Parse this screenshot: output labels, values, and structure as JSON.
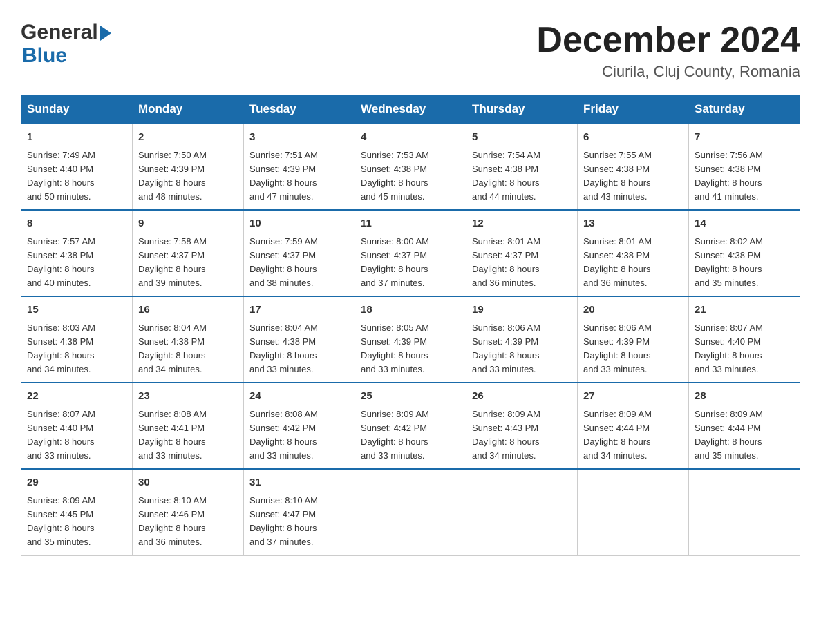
{
  "header": {
    "month_title": "December 2024",
    "location": "Ciurila, Cluj County, Romania",
    "logo_general": "General",
    "logo_blue": "Blue"
  },
  "days_of_week": [
    "Sunday",
    "Monday",
    "Tuesday",
    "Wednesday",
    "Thursday",
    "Friday",
    "Saturday"
  ],
  "weeks": [
    [
      {
        "day": "1",
        "sunrise": "7:49 AM",
        "sunset": "4:40 PM",
        "daylight": "8 hours and 50 minutes."
      },
      {
        "day": "2",
        "sunrise": "7:50 AM",
        "sunset": "4:39 PM",
        "daylight": "8 hours and 48 minutes."
      },
      {
        "day": "3",
        "sunrise": "7:51 AM",
        "sunset": "4:39 PM",
        "daylight": "8 hours and 47 minutes."
      },
      {
        "day": "4",
        "sunrise": "7:53 AM",
        "sunset": "4:38 PM",
        "daylight": "8 hours and 45 minutes."
      },
      {
        "day": "5",
        "sunrise": "7:54 AM",
        "sunset": "4:38 PM",
        "daylight": "8 hours and 44 minutes."
      },
      {
        "day": "6",
        "sunrise": "7:55 AM",
        "sunset": "4:38 PM",
        "daylight": "8 hours and 43 minutes."
      },
      {
        "day": "7",
        "sunrise": "7:56 AM",
        "sunset": "4:38 PM",
        "daylight": "8 hours and 41 minutes."
      }
    ],
    [
      {
        "day": "8",
        "sunrise": "7:57 AM",
        "sunset": "4:38 PM",
        "daylight": "8 hours and 40 minutes."
      },
      {
        "day": "9",
        "sunrise": "7:58 AM",
        "sunset": "4:37 PM",
        "daylight": "8 hours and 39 minutes."
      },
      {
        "day": "10",
        "sunrise": "7:59 AM",
        "sunset": "4:37 PM",
        "daylight": "8 hours and 38 minutes."
      },
      {
        "day": "11",
        "sunrise": "8:00 AM",
        "sunset": "4:37 PM",
        "daylight": "8 hours and 37 minutes."
      },
      {
        "day": "12",
        "sunrise": "8:01 AM",
        "sunset": "4:37 PM",
        "daylight": "8 hours and 36 minutes."
      },
      {
        "day": "13",
        "sunrise": "8:01 AM",
        "sunset": "4:38 PM",
        "daylight": "8 hours and 36 minutes."
      },
      {
        "day": "14",
        "sunrise": "8:02 AM",
        "sunset": "4:38 PM",
        "daylight": "8 hours and 35 minutes."
      }
    ],
    [
      {
        "day": "15",
        "sunrise": "8:03 AM",
        "sunset": "4:38 PM",
        "daylight": "8 hours and 34 minutes."
      },
      {
        "day": "16",
        "sunrise": "8:04 AM",
        "sunset": "4:38 PM",
        "daylight": "8 hours and 34 minutes."
      },
      {
        "day": "17",
        "sunrise": "8:04 AM",
        "sunset": "4:38 PM",
        "daylight": "8 hours and 33 minutes."
      },
      {
        "day": "18",
        "sunrise": "8:05 AM",
        "sunset": "4:39 PM",
        "daylight": "8 hours and 33 minutes."
      },
      {
        "day": "19",
        "sunrise": "8:06 AM",
        "sunset": "4:39 PM",
        "daylight": "8 hours and 33 minutes."
      },
      {
        "day": "20",
        "sunrise": "8:06 AM",
        "sunset": "4:39 PM",
        "daylight": "8 hours and 33 minutes."
      },
      {
        "day": "21",
        "sunrise": "8:07 AM",
        "sunset": "4:40 PM",
        "daylight": "8 hours and 33 minutes."
      }
    ],
    [
      {
        "day": "22",
        "sunrise": "8:07 AM",
        "sunset": "4:40 PM",
        "daylight": "8 hours and 33 minutes."
      },
      {
        "day": "23",
        "sunrise": "8:08 AM",
        "sunset": "4:41 PM",
        "daylight": "8 hours and 33 minutes."
      },
      {
        "day": "24",
        "sunrise": "8:08 AM",
        "sunset": "4:42 PM",
        "daylight": "8 hours and 33 minutes."
      },
      {
        "day": "25",
        "sunrise": "8:09 AM",
        "sunset": "4:42 PM",
        "daylight": "8 hours and 33 minutes."
      },
      {
        "day": "26",
        "sunrise": "8:09 AM",
        "sunset": "4:43 PM",
        "daylight": "8 hours and 34 minutes."
      },
      {
        "day": "27",
        "sunrise": "8:09 AM",
        "sunset": "4:44 PM",
        "daylight": "8 hours and 34 minutes."
      },
      {
        "day": "28",
        "sunrise": "8:09 AM",
        "sunset": "4:44 PM",
        "daylight": "8 hours and 35 minutes."
      }
    ],
    [
      {
        "day": "29",
        "sunrise": "8:09 AM",
        "sunset": "4:45 PM",
        "daylight": "8 hours and 35 minutes."
      },
      {
        "day": "30",
        "sunrise": "8:10 AM",
        "sunset": "4:46 PM",
        "daylight": "8 hours and 36 minutes."
      },
      {
        "day": "31",
        "sunrise": "8:10 AM",
        "sunset": "4:47 PM",
        "daylight": "8 hours and 37 minutes."
      },
      null,
      null,
      null,
      null
    ]
  ],
  "labels": {
    "sunrise": "Sunrise:",
    "sunset": "Sunset:",
    "daylight": "Daylight:"
  }
}
